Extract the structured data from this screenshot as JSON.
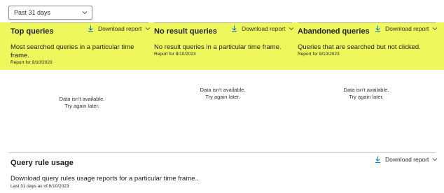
{
  "filter": {
    "selected": "Past 31 days"
  },
  "download_label": "Download report",
  "columns": [
    {
      "title": "Top queries",
      "description": "Most searched queries in a particular time frame.",
      "date": "Report for 8/10/2023",
      "empty_line1": "Data isn't available.",
      "empty_line2": "Try again later."
    },
    {
      "title": "No result queries",
      "description": "No result queries in a particular time frame.",
      "date": "Report for 8/10/2023",
      "empty_line1": "Data isn't available.",
      "empty_line2": "Try again later."
    },
    {
      "title": "Abandoned queries",
      "description": "Queries that are searched but not clicked.",
      "date": "Report for 8/10/2023",
      "empty_line1": "Data isn't available.",
      "empty_line2": "Try again later."
    }
  ],
  "query_rule": {
    "title": "Query rule usage",
    "description": "Download query rules usage reports for a particular time frame..",
    "date": "Last 31 days as of 8/10/2023"
  },
  "colors": {
    "highlight": "#eef75c",
    "accent": "#0078d4"
  },
  "icons": [
    "chevron-down-icon",
    "download-icon"
  ]
}
